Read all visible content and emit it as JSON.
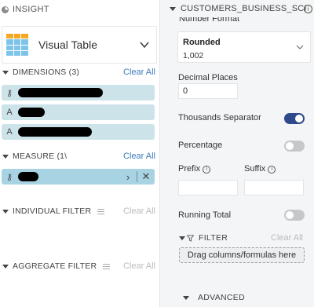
{
  "insight": {
    "title": "INSIGHT",
    "visual_type": "Visual Table",
    "dimensions": {
      "label": "DIMENSIONS (3)",
      "clear_label": "Clear All",
      "fields": [
        {
          "type_icon": "key-icon",
          "glyph": "⚷"
        },
        {
          "type_icon": "text-type-icon",
          "glyph": "A"
        },
        {
          "type_icon": "text-type-icon",
          "glyph": "A"
        }
      ]
    },
    "measure": {
      "label": "MEASURE (1\\",
      "clear_label": "Clear All",
      "fields": [
        {
          "type_icon": "key-icon",
          "glyph": "⚷",
          "expand_glyph": "›",
          "remove_glyph": "✕"
        }
      ]
    },
    "individual_filter": {
      "label": "INDIVIDUAL FILTER",
      "clear_label": "Clear All"
    },
    "aggregate_filter": {
      "label": "AGGREGATE FILTER",
      "clear_label": "Clear All"
    }
  },
  "properties": {
    "source_title": "CUSTOMERS_BUSINESS_SCH...",
    "info_glyph": "i",
    "number_format_label": "Number Format",
    "number_format": {
      "selected": "Rounded",
      "example": "1,002"
    },
    "decimal_places": {
      "label": "Decimal Places",
      "value": "0"
    },
    "thousands_separator": {
      "label": "Thousands Separator",
      "on": true
    },
    "percentage": {
      "label": "Percentage",
      "on": false
    },
    "prefix": {
      "label": "Prefix",
      "value": ""
    },
    "suffix": {
      "label": "Suffix",
      "value": ""
    },
    "running_total": {
      "label": "Running Total",
      "on": false
    },
    "filter": {
      "label": "FILTER",
      "clear_label": "Clear All",
      "drop_hint": "Drag columns/formulas here"
    },
    "advanced": {
      "label": "ADVANCED"
    }
  },
  "colors": {
    "accent_link": "#3a7bbd",
    "toggle_on": "#2f4a8a",
    "toggle_off": "#c5c7ca",
    "dimension_chip": "#cde3ea",
    "measure_chip": "#a8d3e2",
    "table_header": "#f5a623",
    "table_cell": "#7ec4e8"
  }
}
